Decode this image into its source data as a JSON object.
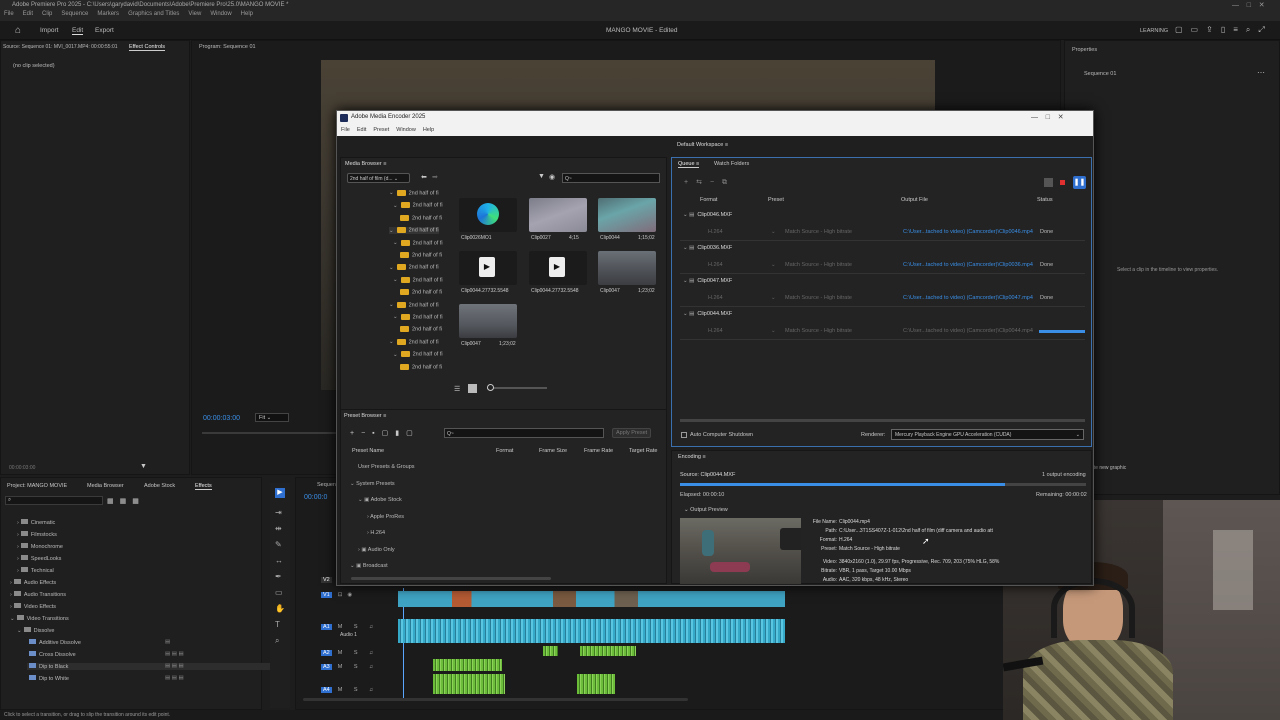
{
  "premiere": {
    "title": "Adobe Premiere Pro 2025 - C:\\Users\\garydavid\\Documents\\Adobe\\Premiere Pro\\25.0\\MANGO MOVIE *",
    "menu": [
      "File",
      "Edit",
      "Clip",
      "Sequence",
      "Markers",
      "Graphics and Titles",
      "View",
      "Window",
      "Help"
    ],
    "workspace_tabs": [
      "Import",
      "Edit",
      "Export"
    ],
    "project_title": "MANGO MOVIE - Edited",
    "learning": "LEARNING",
    "source_tab": "Source: Sequence 01: MVI_0017.MP4: 00:00:55:01",
    "effect_controls": "Effect Controls",
    "no_clip": "(no clip selected)",
    "program_tab": "Program: Sequence 01",
    "properties": "Properties",
    "sequence": "Sequence 01",
    "props_hint": "Select a clip in the timeline to view properties.",
    "timecode": "00:00:03:00",
    "fit": "Fit",
    "src_tc": "00:00:03:00",
    "bottom_tabs": [
      "Project: MANGO MOVIE",
      "Media Browser",
      "Adobe Stock",
      "Effects"
    ],
    "effects_tree": [
      "Cinematic",
      "Filmstocks",
      "Monochrome",
      "SpeedLooks",
      "Technical",
      "Audio Effects",
      "Audio Transitions",
      "Video Effects",
      "Video Transitions",
      "Dissolve",
      "Additive Dissolve",
      "Cross Dissolve",
      "Dip to Black",
      "Dip to White"
    ],
    "timeline_tab": "Sequen",
    "timeline_tc": "00:00:0",
    "tracks": [
      "V2",
      "V1",
      "A1",
      "A2",
      "A3",
      "A4"
    ],
    "audio1": "Audio 1",
    "status_bar": "Click to select a transition, or drag to slip the transition around its edit point.",
    "create_graphic": "ate new graphic"
  },
  "encoder": {
    "title": "Adobe Media Encoder 2025",
    "menu": [
      "File",
      "Edit",
      "Preset",
      "Window",
      "Help"
    ],
    "workspace": "Default Workspace",
    "media_browser": "Media Browser",
    "folder_select": "2nd half of film (d...",
    "folder_rows": [
      "2nd half of fi",
      "2nd half of fi",
      "2nd half of fi",
      "2nd half of fi",
      "2nd half of fi",
      "2nd half of fi",
      "2nd half of fi",
      "2nd half of fi",
      "2nd half of fi",
      "2nd half of fi",
      "2nd half of fi",
      "2nd half of fi",
      "2nd half of fi",
      "2nd half of fi",
      "2nd half of fi"
    ],
    "thumbs": [
      {
        "name": "Clip0026MO1",
        "dur": ""
      },
      {
        "name": "Clip0027",
        "dur": "4;15"
      },
      {
        "name": "Clip0044",
        "dur": "1;15;02"
      },
      {
        "name": "Clip0044.27732.5548",
        "dur": ""
      },
      {
        "name": "Clip0044.27732.5548",
        "dur": ""
      },
      {
        "name": "Clip0047",
        "dur": "1;23;02"
      },
      {
        "name": "Clip0047",
        "dur": "1;23;02"
      }
    ],
    "search_placeholder": "Q~",
    "preset_browser": "Preset Browser",
    "apply_preset": "Apply Preset",
    "preset_cols": [
      "Preset Name",
      "Format",
      "Frame Size",
      "Frame Rate",
      "Target Rate"
    ],
    "preset_rows": [
      "User Presets & Groups",
      "System Presets",
      "Adobe Stock",
      "Apple ProRes",
      "H.264",
      "Audio Only",
      "Broadcast"
    ],
    "queue_tab": "Queue",
    "watch_tab": "Watch Folders",
    "queue_cols": [
      "Format",
      "Preset",
      "Output File",
      "Status"
    ],
    "queue": [
      {
        "clip": "Clip0046.MXF",
        "format": "H.264",
        "preset": "Match Source - High bitrate",
        "output": "C:\\User...tached to video) (Camcorder)\\Clip0046.mp4",
        "status": "Done"
      },
      {
        "clip": "Clip0036.MXF",
        "format": "H.264",
        "preset": "Match Source - High bitrate",
        "output": "C:\\User...tached to video) (Camcorder)\\Clip0036.mp4",
        "status": "Done"
      },
      {
        "clip": "Clip0047.MXF",
        "format": "H.264",
        "preset": "Match Source - High bitrate",
        "output": "C:\\User...tached to video) (Camcorder)\\Clip0047.mp4",
        "status": "Done"
      },
      {
        "clip": "Clip0044.MXF",
        "format": "H.264",
        "preset": "Match Source - High bitrate",
        "output": "C:\\User...tached to video) (Camcorder)\\Clip0044.mp4",
        "status": ""
      }
    ],
    "queue_progress": 1.0,
    "auto_shutdown": "Auto Computer Shutdown",
    "renderer_label": "Renderer:",
    "renderer": "Mercury Playback Engine GPU Acceleration (CUDA)",
    "encoding": "Encoding",
    "source": "Source: Clip0044.MXF",
    "outputs": "1 output encoding",
    "elapsed": "Elapsed: 00:00:10",
    "remaining": "Remaining: 00:00:02",
    "progress": 0.8,
    "output_preview": "Output Preview",
    "info": [
      {
        "k": "File Name:",
        "v": "Clip0044.mp4"
      },
      {
        "k": "Path:",
        "v": "C:\\User...3T1SS407Z-1-012\\2nd half of film (diff camera and audio att"
      },
      {
        "k": "Format:",
        "v": "H.264"
      },
      {
        "k": "Preset:",
        "v": "Match Source - High bitrate"
      },
      {
        "k": "Video:",
        "v": "3840x2160 (1.0), 29.97 fps, Progressive, Rec. 709, 203 (75% HLG, 58%"
      },
      {
        "k": "Bitrate:",
        "v": "VBR, 1 pass, Target 10.00 Mbps"
      },
      {
        "k": "Audio:",
        "v": "AAC, 320 kbps, 48 kHz, Stereo"
      }
    ]
  }
}
